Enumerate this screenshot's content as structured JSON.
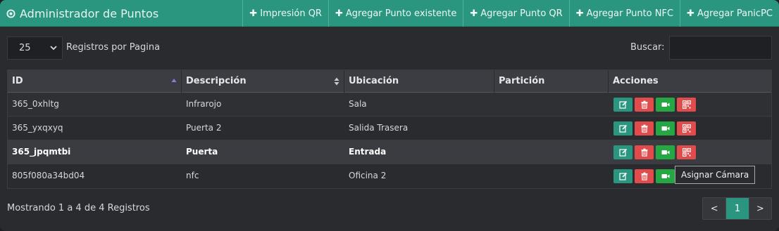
{
  "header": {
    "title": "Administrador de Puntos",
    "nav": [
      {
        "label": "Impresión QR"
      },
      {
        "label": "Agregar Punto existente"
      },
      {
        "label": "Agregar Punto QR"
      },
      {
        "label": "Agregar Punto NFC"
      },
      {
        "label": "Agregar PanicPC"
      }
    ]
  },
  "controls": {
    "page_length": "25",
    "page_length_label": "Registros por Pagina",
    "search_label": "Buscar:",
    "search_value": ""
  },
  "table": {
    "columns": [
      "ID",
      "Descripción",
      "Ubicación",
      "Partición",
      "Acciones"
    ],
    "rows": [
      {
        "id": "365_0xhltg",
        "descripcion": "Infrarojo",
        "ubicacion": "Sala",
        "particion": ""
      },
      {
        "id": "365_yxqxyq",
        "descripcion": "Puerta 2",
        "ubicacion": "Salida Trasera",
        "particion": ""
      },
      {
        "id": "365_jpqmtbi",
        "descripcion": "Puerta",
        "ubicacion": "Entrada",
        "particion": ""
      },
      {
        "id": "805f080a34bd04",
        "descripcion": "nfc",
        "ubicacion": "Oficina 2",
        "particion": ""
      }
    ]
  },
  "tooltip": "Asignar Cámara",
  "footer": {
    "info": "Mostrando 1 a 4 de 4 Registros",
    "prev": "<",
    "page": "1",
    "next": ">"
  },
  "colors": {
    "header": "#2a9680",
    "edit": "#2a9680",
    "delete": "#e14b4b",
    "camera": "#25a744",
    "qr": "#e14b4b"
  },
  "icons": {
    "header": "dot-circle-icon",
    "nav": "plus-icon",
    "actions": [
      "edit-icon",
      "trash-icon",
      "video-camera-icon",
      "qr-code-icon"
    ]
  }
}
